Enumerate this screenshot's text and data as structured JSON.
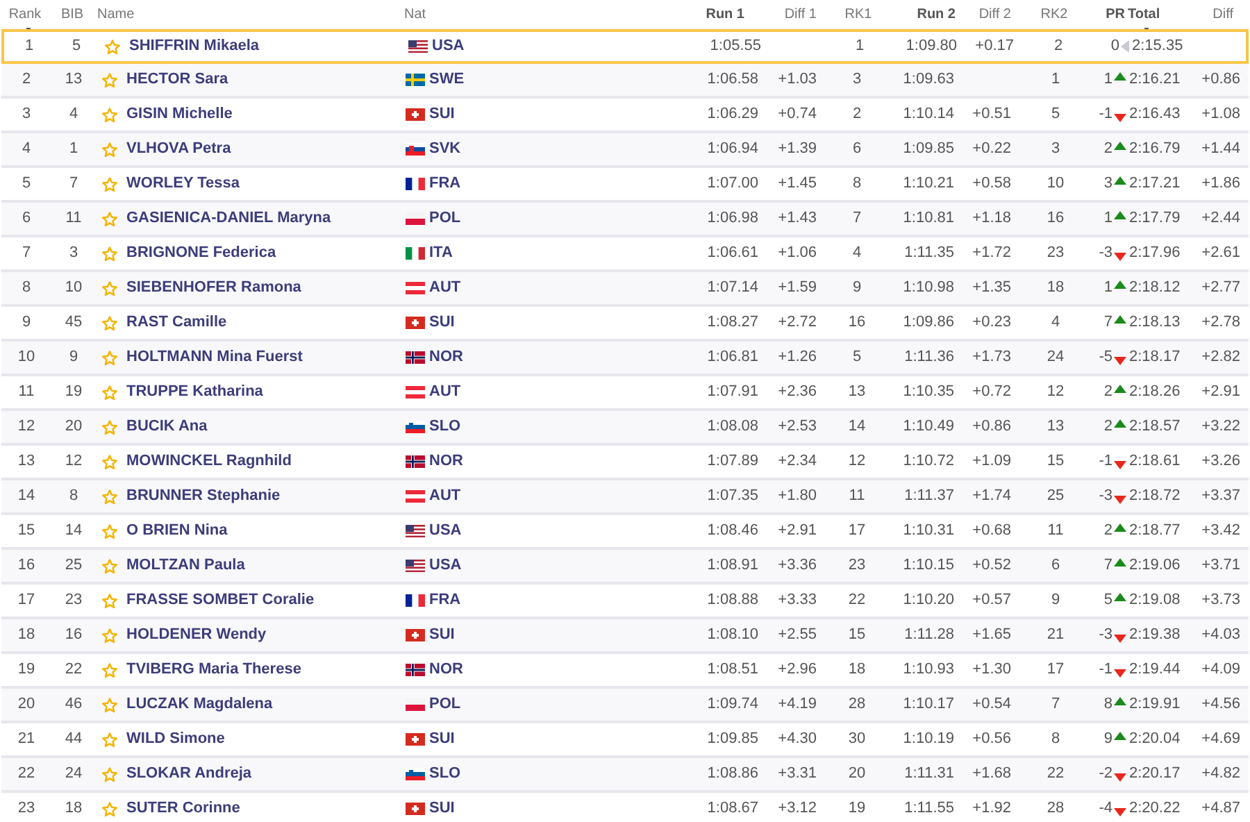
{
  "columns": [
    {
      "label": "Rank",
      "emphasis": false,
      "sorted": true
    },
    {
      "label": "BIB",
      "emphasis": false,
      "sorted": false
    },
    {
      "label": "Name",
      "emphasis": false,
      "sorted": false
    },
    {
      "label": "Nat",
      "emphasis": false,
      "sorted": false
    },
    {
      "label": "Run 1",
      "emphasis": true,
      "sorted": false
    },
    {
      "label": "Diff 1",
      "emphasis": false,
      "sorted": false
    },
    {
      "label": "RK1",
      "emphasis": false,
      "sorted": false
    },
    {
      "label": "Run 2",
      "emphasis": true,
      "sorted": false
    },
    {
      "label": "Diff 2",
      "emphasis": false,
      "sorted": false
    },
    {
      "label": "RK2",
      "emphasis": false,
      "sorted": false
    },
    {
      "label": "PR",
      "emphasis": true,
      "sorted": false
    },
    {
      "label": "Total",
      "emphasis": true,
      "sorted": true
    },
    {
      "label": "Diff",
      "emphasis": false,
      "sorted": false
    }
  ],
  "rows": [
    {
      "rank": "1",
      "bib": "5",
      "name": "SHIFFRIN Mikaela",
      "nat": {
        "kind": "us",
        "code": "USA"
      },
      "run_1": "1:05.55",
      "rk1": "1",
      "run_2": "1:09.80",
      "diff_2": "+0.17",
      "rk2": "2",
      "pr": {
        "value": "0",
        "kind": "same"
      },
      "total": "2:15.35",
      "selected": true
    },
    {
      "rank": "2",
      "bib": "13",
      "name": "HECTOR Sara",
      "nat": {
        "kind": "se",
        "code": "SWE"
      },
      "run_1": "1:06.58",
      "diff_1": "+1.03",
      "rk1": "3",
      "run_2": "1:09.63",
      "rk2": "1",
      "pr": {
        "value": "1",
        "kind": "up"
      },
      "total": "2:16.21",
      "diff": "+0.86",
      "selected": false
    },
    {
      "rank": "3",
      "bib": "4",
      "name": "GISIN Michelle",
      "nat": {
        "kind": "ch",
        "code": "SUI"
      },
      "run_1": "1:06.29",
      "diff_1": "+0.74",
      "rk1": "2",
      "run_2": "1:10.14",
      "diff_2": "+0.51",
      "rk2": "5",
      "pr": {
        "value": "-1",
        "kind": "down"
      },
      "total": "2:16.43",
      "diff": "+1.08",
      "selected": false
    },
    {
      "rank": "4",
      "bib": "1",
      "name": "VLHOVA Petra",
      "nat": {
        "kind": "sk",
        "code": "SVK"
      },
      "run_1": "1:06.94",
      "diff_1": "+1.39",
      "rk1": "6",
      "run_2": "1:09.85",
      "diff_2": "+0.22",
      "rk2": "3",
      "pr": {
        "value": "2",
        "kind": "up"
      },
      "total": "2:16.79",
      "diff": "+1.44",
      "selected": false
    },
    {
      "rank": "5",
      "bib": "7",
      "name": "WORLEY Tessa",
      "nat": {
        "kind": "fr",
        "code": "FRA"
      },
      "run_1": "1:07.00",
      "diff_1": "+1.45",
      "rk1": "8",
      "run_2": "1:10.21",
      "diff_2": "+0.58",
      "rk2": "10",
      "pr": {
        "value": "3",
        "kind": "up"
      },
      "total": "2:17.21",
      "diff": "+1.86",
      "selected": false
    },
    {
      "rank": "6",
      "bib": "11",
      "name": "GASIENICA-DANIEL Maryna",
      "nat": {
        "kind": "pl",
        "code": "POL"
      },
      "run_1": "1:06.98",
      "diff_1": "+1.43",
      "rk1": "7",
      "run_2": "1:10.81",
      "diff_2": "+1.18",
      "rk2": "16",
      "pr": {
        "value": "1",
        "kind": "up"
      },
      "total": "2:17.79",
      "diff": "+2.44",
      "selected": false
    },
    {
      "rank": "7",
      "bib": "3",
      "name": "BRIGNONE Federica",
      "nat": {
        "kind": "it",
        "code": "ITA"
      },
      "run_1": "1:06.61",
      "diff_1": "+1.06",
      "rk1": "4",
      "run_2": "1:11.35",
      "diff_2": "+1.72",
      "rk2": "23",
      "pr": {
        "value": "-3",
        "kind": "down"
      },
      "total": "2:17.96",
      "diff": "+2.61",
      "selected": false
    },
    {
      "rank": "8",
      "bib": "10",
      "name": "SIEBENHOFER Ramona",
      "nat": {
        "kind": "at",
        "code": "AUT"
      },
      "run_1": "1:07.14",
      "diff_1": "+1.59",
      "rk1": "9",
      "run_2": "1:10.98",
      "diff_2": "+1.35",
      "rk2": "18",
      "pr": {
        "value": "1",
        "kind": "up"
      },
      "total": "2:18.12",
      "diff": "+2.77",
      "selected": false
    },
    {
      "rank": "9",
      "bib": "45",
      "name": "RAST Camille",
      "nat": {
        "kind": "ch",
        "code": "SUI"
      },
      "run_1": "1:08.27",
      "diff_1": "+2.72",
      "rk1": "16",
      "run_2": "1:09.86",
      "diff_2": "+0.23",
      "rk2": "4",
      "pr": {
        "value": "7",
        "kind": "up"
      },
      "total": "2:18.13",
      "diff": "+2.78",
      "selected": false
    },
    {
      "rank": "10",
      "bib": "9",
      "name": "HOLTMANN Mina Fuerst",
      "nat": {
        "kind": "no",
        "code": "NOR"
      },
      "run_1": "1:06.81",
      "diff_1": "+1.26",
      "rk1": "5",
      "run_2": "1:11.36",
      "diff_2": "+1.73",
      "rk2": "24",
      "pr": {
        "value": "-5",
        "kind": "down"
      },
      "total": "2:18.17",
      "diff": "+2.82",
      "selected": false
    },
    {
      "rank": "11",
      "bib": "19",
      "name": "TRUPPE Katharina",
      "nat": {
        "kind": "at",
        "code": "AUT"
      },
      "run_1": "1:07.91",
      "diff_1": "+2.36",
      "rk1": "13",
      "run_2": "1:10.35",
      "diff_2": "+0.72",
      "rk2": "12",
      "pr": {
        "value": "2",
        "kind": "up"
      },
      "total": "2:18.26",
      "diff": "+2.91",
      "selected": false
    },
    {
      "rank": "12",
      "bib": "20",
      "name": "BUCIK Ana",
      "nat": {
        "kind": "si",
        "code": "SLO"
      },
      "run_1": "1:08.08",
      "diff_1": "+2.53",
      "rk1": "14",
      "run_2": "1:10.49",
      "diff_2": "+0.86",
      "rk2": "13",
      "pr": {
        "value": "2",
        "kind": "up"
      },
      "total": "2:18.57",
      "diff": "+3.22",
      "selected": false
    },
    {
      "rank": "13",
      "bib": "12",
      "name": "MOWINCKEL Ragnhild",
      "nat": {
        "kind": "no",
        "code": "NOR"
      },
      "run_1": "1:07.89",
      "diff_1": "+2.34",
      "rk1": "12",
      "run_2": "1:10.72",
      "diff_2": "+1.09",
      "rk2": "15",
      "pr": {
        "value": "-1",
        "kind": "down"
      },
      "total": "2:18.61",
      "diff": "+3.26",
      "selected": false
    },
    {
      "rank": "14",
      "bib": "8",
      "name": "BRUNNER Stephanie",
      "nat": {
        "kind": "at",
        "code": "AUT"
      },
      "run_1": "1:07.35",
      "diff_1": "+1.80",
      "rk1": "11",
      "run_2": "1:11.37",
      "diff_2": "+1.74",
      "rk2": "25",
      "pr": {
        "value": "-3",
        "kind": "down"
      },
      "total": "2:18.72",
      "diff": "+3.37",
      "selected": false
    },
    {
      "rank": "15",
      "bib": "14",
      "name": "O BRIEN Nina",
      "nat": {
        "kind": "us",
        "code": "USA"
      },
      "run_1": "1:08.46",
      "diff_1": "+2.91",
      "rk1": "17",
      "run_2": "1:10.31",
      "diff_2": "+0.68",
      "rk2": "11",
      "pr": {
        "value": "2",
        "kind": "up"
      },
      "total": "2:18.77",
      "diff": "+3.42",
      "selected": false
    },
    {
      "rank": "16",
      "bib": "25",
      "name": "MOLTZAN Paula",
      "nat": {
        "kind": "us",
        "code": "USA"
      },
      "run_1": "1:08.91",
      "diff_1": "+3.36",
      "rk1": "23",
      "run_2": "1:10.15",
      "diff_2": "+0.52",
      "rk2": "6",
      "pr": {
        "value": "7",
        "kind": "up"
      },
      "total": "2:19.06",
      "diff": "+3.71",
      "selected": false
    },
    {
      "rank": "17",
      "bib": "23",
      "name": "FRASSE SOMBET Coralie",
      "nat": {
        "kind": "fr",
        "code": "FRA"
      },
      "run_1": "1:08.88",
      "diff_1": "+3.33",
      "rk1": "22",
      "run_2": "1:10.20",
      "diff_2": "+0.57",
      "rk2": "9",
      "pr": {
        "value": "5",
        "kind": "up"
      },
      "total": "2:19.08",
      "diff": "+3.73",
      "selected": false
    },
    {
      "rank": "18",
      "bib": "16",
      "name": "HOLDENER Wendy",
      "nat": {
        "kind": "ch",
        "code": "SUI"
      },
      "run_1": "1:08.10",
      "diff_1": "+2.55",
      "rk1": "15",
      "run_2": "1:11.28",
      "diff_2": "+1.65",
      "rk2": "21",
      "pr": {
        "value": "-3",
        "kind": "down"
      },
      "total": "2:19.38",
      "diff": "+4.03",
      "selected": false
    },
    {
      "rank": "19",
      "bib": "22",
      "name": "TVIBERG Maria Therese",
      "nat": {
        "kind": "no",
        "code": "NOR"
      },
      "run_1": "1:08.51",
      "diff_1": "+2.96",
      "rk1": "18",
      "run_2": "1:10.93",
      "diff_2": "+1.30",
      "rk2": "17",
      "pr": {
        "value": "-1",
        "kind": "down"
      },
      "total": "2:19.44",
      "diff": "+4.09",
      "selected": false
    },
    {
      "rank": "20",
      "bib": "46",
      "name": "LUCZAK Magdalena",
      "nat": {
        "kind": "pl",
        "code": "POL"
      },
      "run_1": "1:09.74",
      "diff_1": "+4.19",
      "rk1": "28",
      "run_2": "1:10.17",
      "diff_2": "+0.54",
      "rk2": "7",
      "pr": {
        "value": "8",
        "kind": "up"
      },
      "total": "2:19.91",
      "diff": "+4.56",
      "selected": false
    },
    {
      "rank": "21",
      "bib": "44",
      "name": "WILD Simone",
      "nat": {
        "kind": "ch",
        "code": "SUI"
      },
      "run_1": "1:09.85",
      "diff_1": "+4.30",
      "rk1": "30",
      "run_2": "1:10.19",
      "diff_2": "+0.56",
      "rk2": "8",
      "pr": {
        "value": "9",
        "kind": "up"
      },
      "total": "2:20.04",
      "diff": "+4.69",
      "selected": false
    },
    {
      "rank": "22",
      "bib": "24",
      "name": "SLOKAR Andreja",
      "nat": {
        "kind": "si",
        "code": "SLO"
      },
      "run_1": "1:08.86",
      "diff_1": "+3.31",
      "rk1": "20",
      "run_2": "1:11.31",
      "diff_2": "+1.68",
      "rk2": "22",
      "pr": {
        "value": "-2",
        "kind": "down"
      },
      "total": "2:20.17",
      "diff": "+4.82",
      "selected": false
    },
    {
      "rank": "23",
      "bib": "18",
      "name": "SUTER Corinne",
      "nat": {
        "kind": "ch",
        "code": "SUI"
      },
      "run_1": "1:08.67",
      "diff_1": "+3.12",
      "rk1": "19",
      "run_2": "1:11.55",
      "diff_2": "+1.92",
      "rk2": "28",
      "pr": {
        "value": "-4",
        "kind": "down"
      },
      "total": "2:20.22",
      "diff": "+4.87",
      "selected": false
    }
  ]
}
